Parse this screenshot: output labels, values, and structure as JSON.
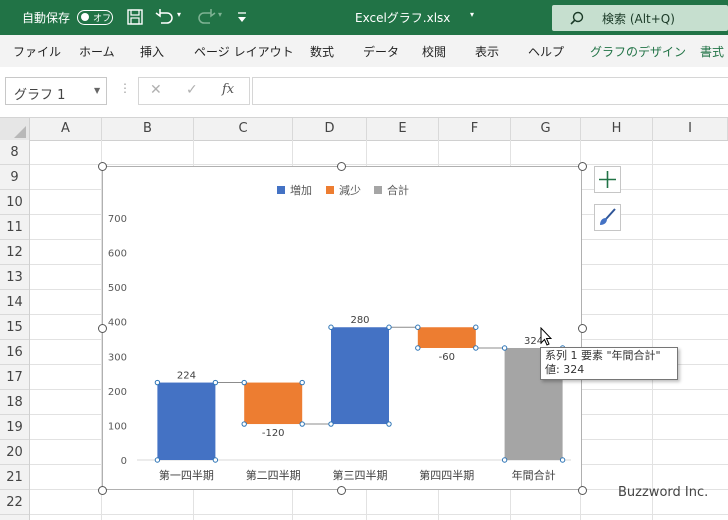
{
  "titlebar": {
    "autosave_label": "自動保存",
    "autosave_state": "オフ",
    "file_name": "Excelグラフ.xlsx",
    "search_label": "検索 (Alt+Q)"
  },
  "ribbon": {
    "tabs": [
      "ファイル",
      "ホーム",
      "挿入",
      "ページ レイアウト",
      "数式",
      "データ",
      "校閲",
      "表示",
      "ヘルプ",
      "グラフのデザイン",
      "書式"
    ]
  },
  "formula_bar": {
    "name_box": "グラフ 1",
    "cancel_glyph": "✕",
    "enter_glyph": "✓",
    "fx_label": "fx",
    "value": ""
  },
  "sheet": {
    "columns": [
      "A",
      "B",
      "C",
      "D",
      "E",
      "F",
      "G",
      "H",
      "I"
    ],
    "rows": [
      "8",
      "9",
      "10",
      "11",
      "12",
      "13",
      "14",
      "15",
      "16",
      "17",
      "18",
      "19",
      "20",
      "21",
      "22"
    ]
  },
  "chart_data": {
    "type": "waterfall",
    "legend": [
      "増加",
      "減少",
      "合計"
    ],
    "legend_position": "top",
    "categories": [
      "第一四半期",
      "第二四半期",
      "第三四半期",
      "第四四半期",
      "年間合計"
    ],
    "values": [
      224,
      -120,
      280,
      -60,
      324
    ],
    "value_labels": [
      "224",
      "-120",
      "280",
      "-60",
      "324"
    ],
    "kinds": [
      "increase",
      "decrease",
      "increase",
      "decrease",
      "total"
    ],
    "ylim": [
      0,
      700
    ],
    "yticks": [
      0,
      100,
      200,
      300,
      400,
      500,
      600,
      700
    ],
    "colors": {
      "increase": "#4472c4",
      "decrease": "#ed7d31",
      "total": "#a5a5a5"
    },
    "selected_point": "年間合計"
  },
  "tooltip": {
    "line1": "系列 1 要素 \"年間合計\"",
    "line2": "値: 324"
  },
  "watermark": "Buzzword Inc."
}
